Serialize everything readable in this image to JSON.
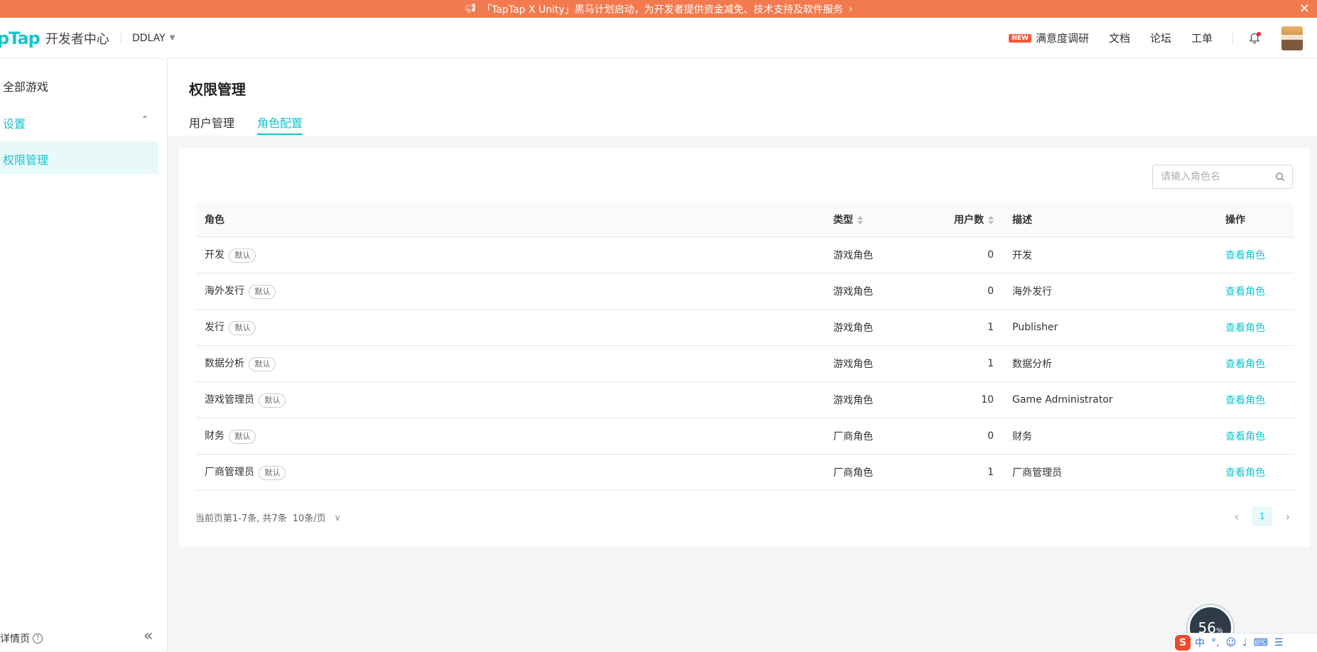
{
  "banner": {
    "text": "「TapTap X Unity」黑马计划启动，为开发者提供资金减免、技术支持及软件服务"
  },
  "header": {
    "logo_brand": "pTap",
    "logo_sub": "开发者中心",
    "org_name": "DDLAY",
    "new_badge": "NEW",
    "links": {
      "survey": "满意度调研",
      "docs": "文档",
      "forum": "论坛",
      "ticket": "工单"
    }
  },
  "sidebar": {
    "items": [
      {
        "label": "全部游戏"
      },
      {
        "label": "设置"
      },
      {
        "label": "权限管理"
      }
    ],
    "bottom_label": "详情页"
  },
  "page": {
    "title": "权限管理",
    "tabs": [
      {
        "label": "用户管理",
        "active": false
      },
      {
        "label": "角色配置",
        "active": true
      }
    ]
  },
  "search": {
    "placeholder": "请输入角色名"
  },
  "table": {
    "headers": {
      "role": "角色",
      "type": "类型",
      "users": "用户数",
      "desc": "描述",
      "op": "操作"
    },
    "tag_label": "默认",
    "rows": [
      {
        "role": "开发",
        "type": "游戏角色",
        "users": "0",
        "desc": "开发",
        "op": "查看角色"
      },
      {
        "role": "海外发行",
        "type": "游戏角色",
        "users": "0",
        "desc": "海外发行",
        "op": "查看角色"
      },
      {
        "role": "发行",
        "type": "游戏角色",
        "users": "1",
        "desc": "Publisher",
        "op": "查看角色"
      },
      {
        "role": "数据分析",
        "type": "游戏角色",
        "users": "1",
        "desc": "数据分析",
        "op": "查看角色"
      },
      {
        "role": "游戏管理员",
        "type": "游戏角色",
        "users": "10",
        "desc": "Game Administrator",
        "op": "查看角色"
      },
      {
        "role": "财务",
        "type": "厂商角色",
        "users": "0",
        "desc": "财务",
        "op": "查看角色"
      },
      {
        "role": "厂商管理员",
        "type": "厂商角色",
        "users": "1",
        "desc": "厂商管理员",
        "op": "查看角色"
      }
    ]
  },
  "pagination": {
    "summary": "当前页第1-7条, 共7条",
    "page_size": "10条/页",
    "current_page": "1"
  },
  "widget": {
    "value": "56",
    "unit": "%"
  },
  "ime": {
    "logo": "S",
    "lang": "中"
  },
  "colors": {
    "accent": "#15c5ce",
    "banner": "#f27a4e",
    "new_badge": "#f15a3a"
  }
}
